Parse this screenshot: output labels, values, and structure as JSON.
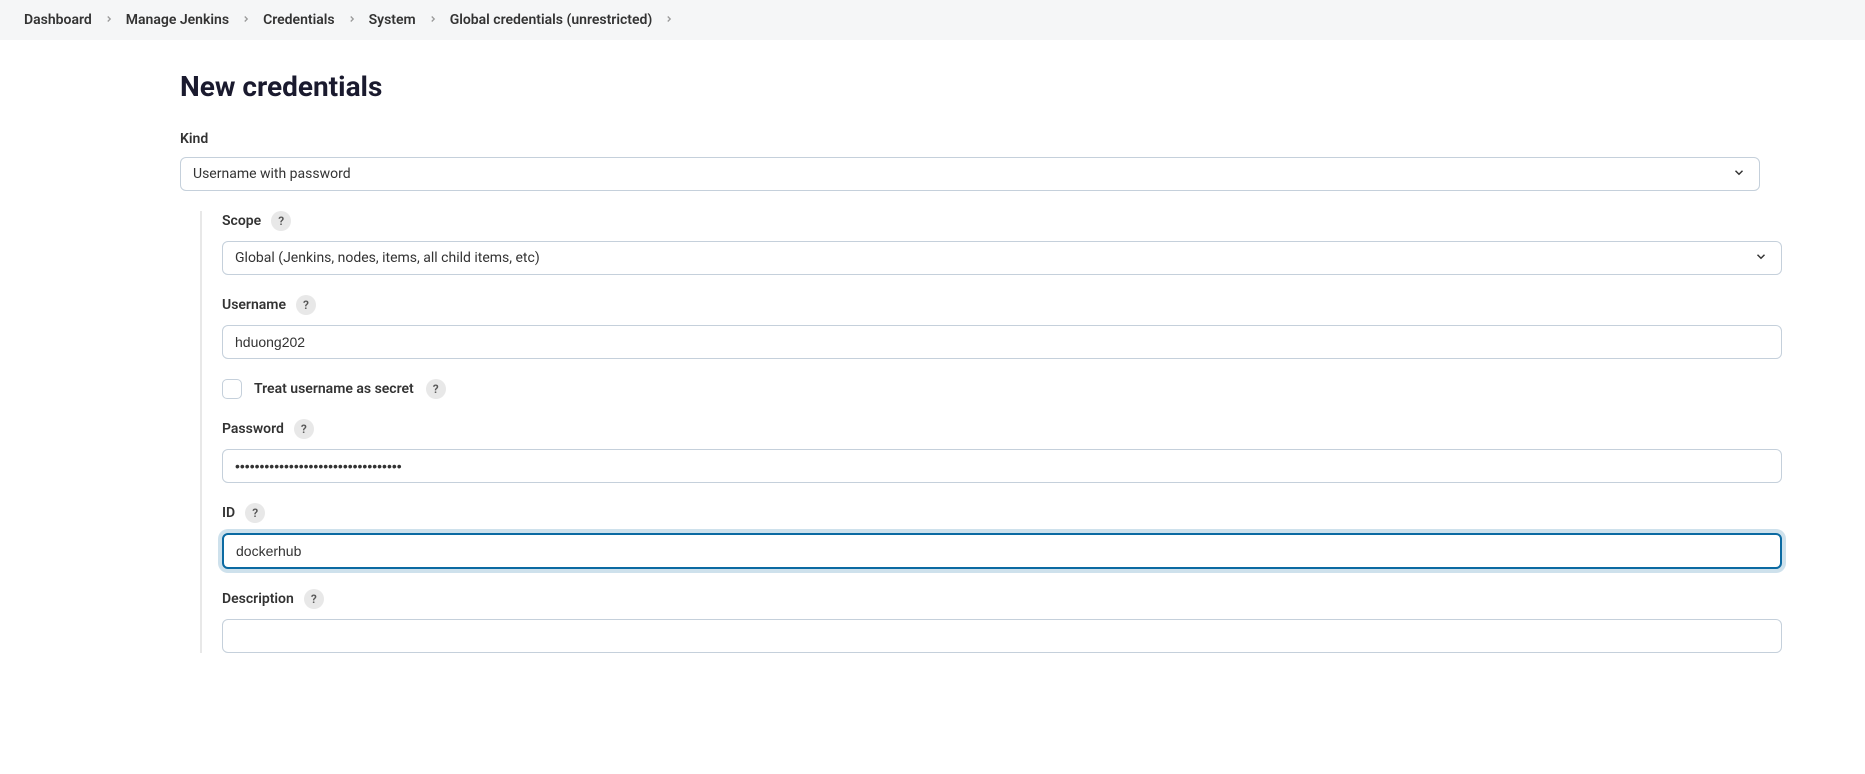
{
  "breadcrumbs": [
    "Dashboard",
    "Manage Jenkins",
    "Credentials",
    "System",
    "Global credentials (unrestricted)"
  ],
  "page": {
    "title": "New credentials"
  },
  "form": {
    "kind": {
      "label": "Kind",
      "value": "Username with password"
    },
    "scope": {
      "label": "Scope",
      "value": "Global (Jenkins, nodes, items, all child items, etc)"
    },
    "username": {
      "label": "Username",
      "value": "hduong202"
    },
    "treat_secret": {
      "label": "Treat username as secret",
      "checked": false
    },
    "password": {
      "label": "Password",
      "value": "••••••••••••••••••••••••••••••••••"
    },
    "id": {
      "label": "ID",
      "value": "dockerhub"
    },
    "description": {
      "label": "Description",
      "value": ""
    }
  },
  "help_symbol": "?"
}
